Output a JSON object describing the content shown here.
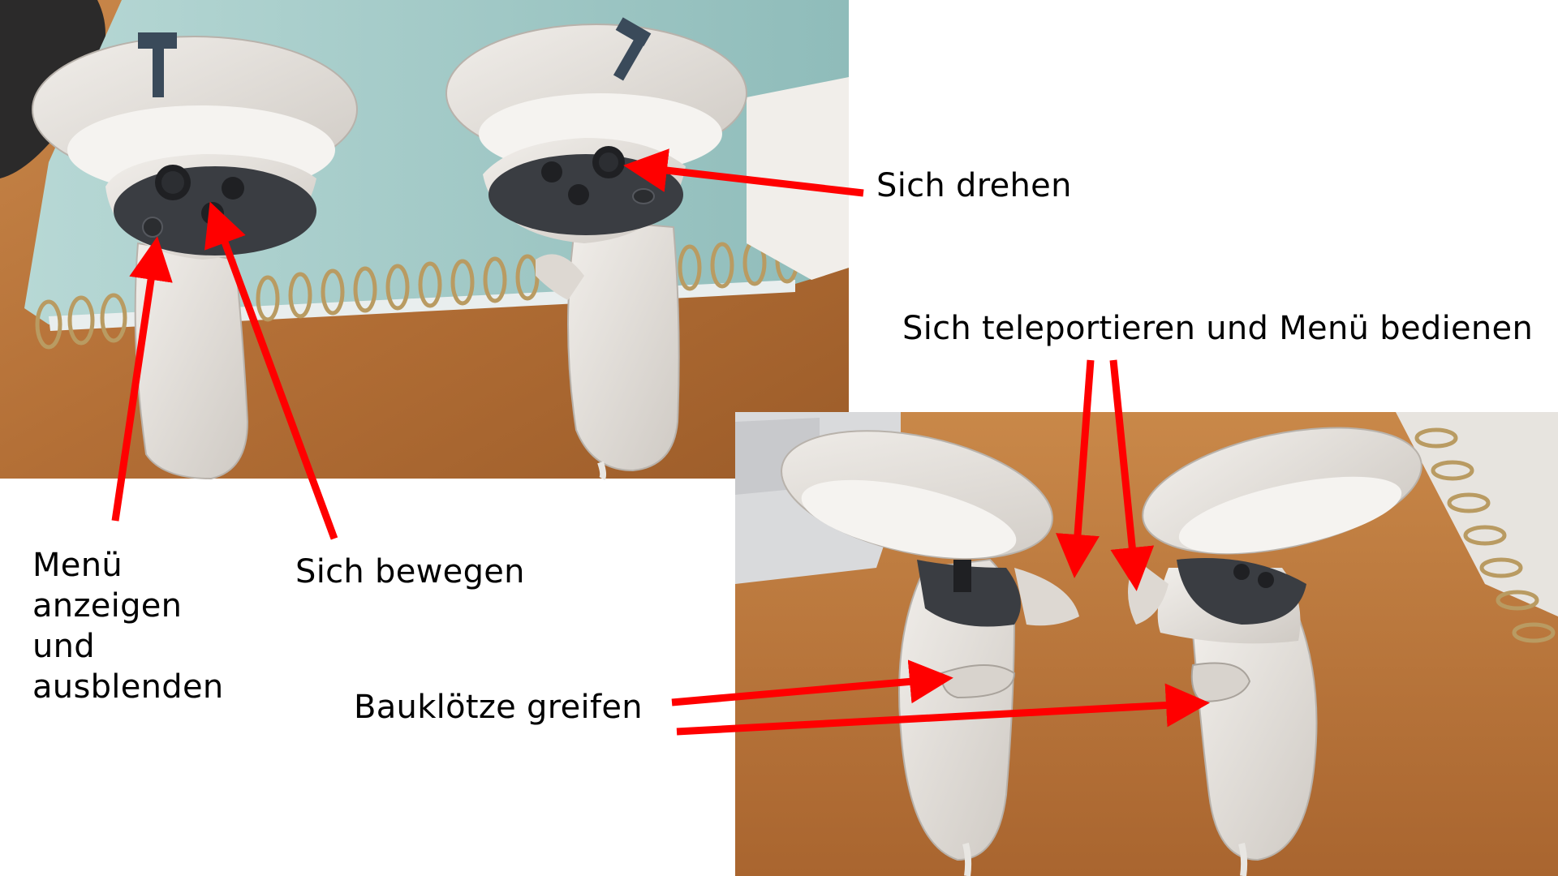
{
  "labels": {
    "sich_drehen": "Sich drehen",
    "sich_teleportieren": "Sich teleportieren und Menü bedienen",
    "menue_lines": [
      "Menü",
      "anzeigen",
      "und",
      "ausblenden"
    ],
    "sich_bewegen": "Sich bewegen",
    "baukloetze_greifen": "Bauklötze greifen"
  },
  "photos": {
    "top": "controller-front-photo",
    "bottom": "controller-side-photo"
  },
  "colors": {
    "arrow": "#ff0000",
    "desk_wood": "#b8743a",
    "notebook": "#9fc9c7",
    "controller_shell": "#e7e3df",
    "button_panel": "#3a3d42"
  }
}
